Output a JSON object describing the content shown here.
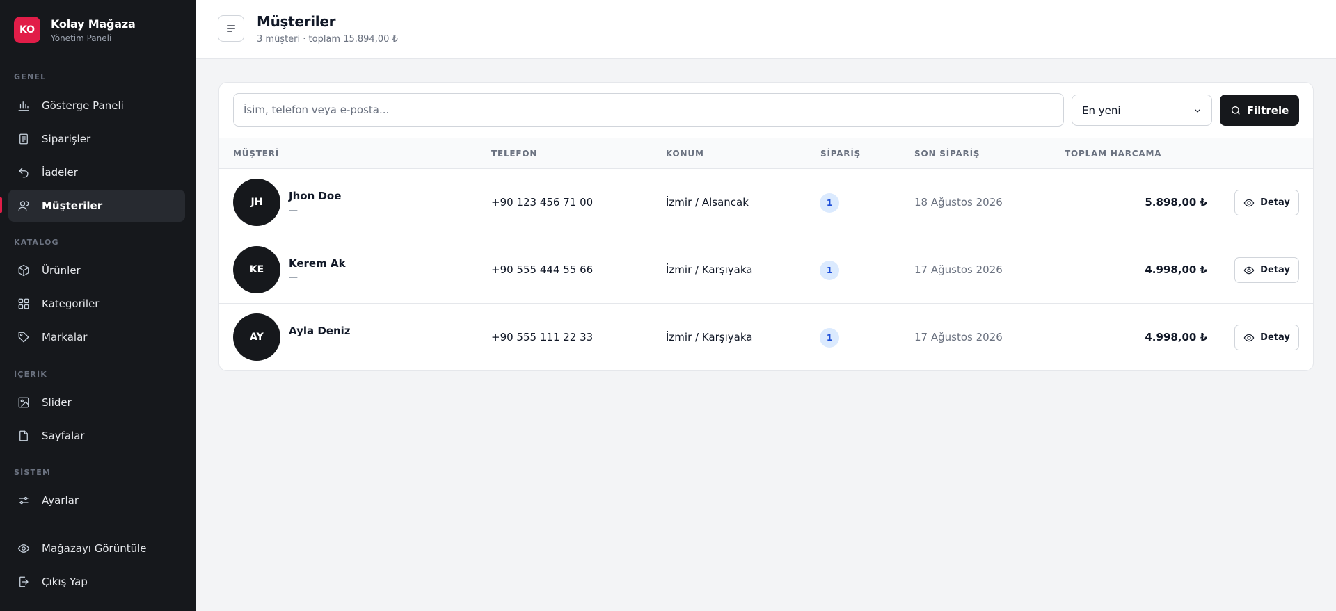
{
  "brand": {
    "initials": "KO",
    "title": "Kolay Mağaza",
    "subtitle": "Yönetim Paneli"
  },
  "sidebar": {
    "sections": [
      {
        "label": "GENEL"
      },
      {
        "label": "KATALOG"
      },
      {
        "label": "İÇERİK"
      },
      {
        "label": "SİSTEM"
      }
    ],
    "items": [
      {
        "label": "Gösterge Paneli",
        "icon": "chart-icon"
      },
      {
        "label": "Siparişler",
        "icon": "receipt-icon"
      },
      {
        "label": "İadeler",
        "icon": "undo-icon"
      },
      {
        "label": "Müşteriler",
        "icon": "users-icon",
        "active": true
      },
      {
        "label": "Ürünler",
        "icon": "box-icon"
      },
      {
        "label": "Kategoriler",
        "icon": "grid-icon"
      },
      {
        "label": "Markalar",
        "icon": "tag-icon"
      },
      {
        "label": "Slider",
        "icon": "image-icon"
      },
      {
        "label": "Sayfalar",
        "icon": "file-icon"
      },
      {
        "label": "Ayarlar",
        "icon": "sliders-icon"
      }
    ],
    "footer": [
      {
        "label": "Mağazayı Görüntüle",
        "icon": "eye-icon"
      },
      {
        "label": "Çıkış Yap",
        "icon": "logout-icon"
      }
    ]
  },
  "header": {
    "title": "Müşteriler",
    "subtitle": "3 müşteri · toplam 15.894,00 ₺"
  },
  "filters": {
    "search_placeholder": "İsim, telefon veya e-posta...",
    "sort_value": "En yeni",
    "filter_label": "Filtrele"
  },
  "table": {
    "headers": [
      "MÜŞTERİ",
      "TELEFON",
      "KONUM",
      "SİPARİŞ",
      "SON SİPARİŞ",
      "TOPLAM HARCAMA"
    ],
    "rows": [
      {
        "initials": "JH",
        "name": "Jhon Doe",
        "email": "—",
        "phone": "+90 123 456 71 00",
        "location": "İzmir / Alsancak",
        "orders": "1",
        "last_order": "18 Ağustos 2026",
        "total": "5.898,00 ₺",
        "action": "Detay"
      },
      {
        "initials": "KE",
        "name": "Kerem Ak",
        "email": "—",
        "phone": "+90 555 444 55 66",
        "location": "İzmir / Karşıyaka",
        "orders": "1",
        "last_order": "17 Ağustos 2026",
        "total": "4.998,00 ₺",
        "action": "Detay"
      },
      {
        "initials": "AY",
        "name": "Ayla Deniz",
        "email": "—",
        "phone": "+90 555 111 22 33",
        "location": "İzmir / Karşıyaka",
        "orders": "1",
        "last_order": "17 Ağustos 2026",
        "total": "4.998,00 ₺",
        "action": "Detay"
      }
    ]
  },
  "colors": {
    "accent": "#e11d48",
    "sidebar_bg": "#16181c",
    "primary_button": "#16181c",
    "badge_bg": "#dbeafe"
  }
}
